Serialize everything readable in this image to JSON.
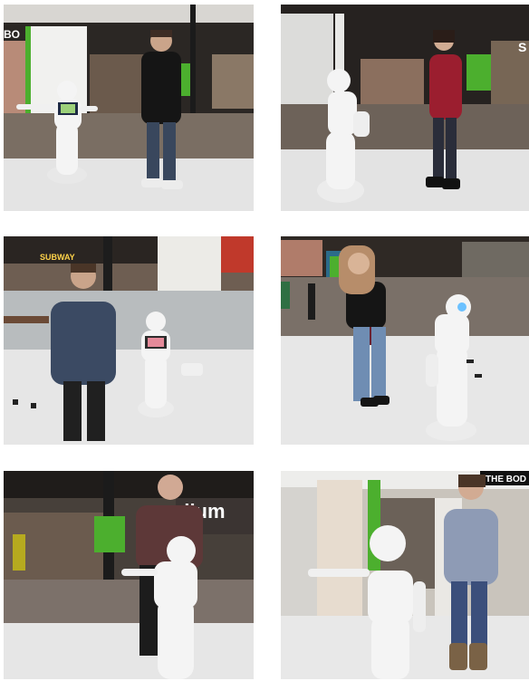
{
  "grid": {
    "panels": [
      {
        "id": "p1",
        "store_sign": "BO",
        "robot_screen": "tablet"
      },
      {
        "id": "p2",
        "store_sign": "S"
      },
      {
        "id": "p3",
        "store_sign": "SUBWAY",
        "sign2": ""
      },
      {
        "id": "p4",
        "store_sign": ""
      },
      {
        "id": "p5",
        "store_sign": "dium"
      },
      {
        "id": "p6",
        "store_sign": "THE BOD"
      }
    ]
  },
  "palette": {
    "floor_white": "#e9e9e9",
    "mall_dark": "#2a2622",
    "robot_white": "#f4f4f4",
    "green_sign": "#4caf2e",
    "red_sign": "#c0392b"
  }
}
